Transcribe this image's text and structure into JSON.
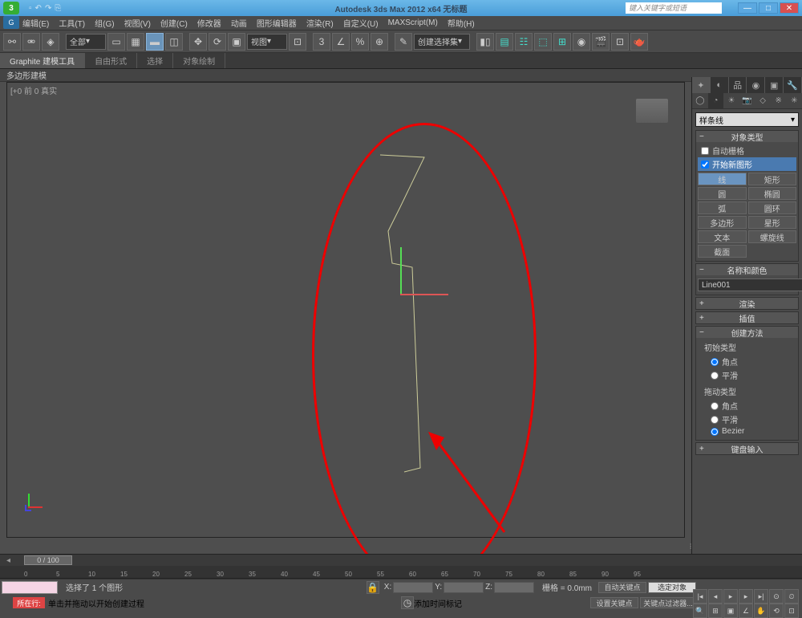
{
  "title": "Autodesk 3ds Max 2012 x64   无标题",
  "search_placeholder": "键入关键字或短语",
  "menus": [
    "编辑(E)",
    "工具(T)",
    "组(G)",
    "视图(V)",
    "创建(C)",
    "修改器",
    "动画",
    "图形编辑器",
    "渲染(R)",
    "自定义(U)",
    "MAXScript(M)",
    "帮助(H)"
  ],
  "toolbar": {
    "sel_filter": "全部",
    "view_label": "视图",
    "cmd_set": "创建选择集"
  },
  "ribbon": {
    "tabs": [
      "Graphite 建模工具",
      "自由形式",
      "选择",
      "对象绘制"
    ],
    "row": "多边形建模"
  },
  "viewport": {
    "label": "[+0 前 0 真实"
  },
  "panel": {
    "dropdown": "样条线",
    "object_type": "对象类型",
    "auto_grid": "自动栅格",
    "start_new": "开始新图形",
    "shapes": [
      [
        "线",
        "矩形"
      ],
      [
        "圆",
        "椭圆"
      ],
      [
        "弧",
        "圆环"
      ],
      [
        "多边形",
        "星形"
      ],
      [
        "文本",
        "螺旋线"
      ],
      [
        "截面",
        ""
      ]
    ],
    "name_color": "名称和颜色",
    "obj_name": "Line001",
    "render": "渲染",
    "interp": "插值",
    "create_method": "创建方法",
    "initial_type": "初始类型",
    "drag_type": "拖动类型",
    "corner": "角点",
    "smooth": "平滑",
    "bezier": "Bezier",
    "keyboard": "键盘输入"
  },
  "timeline": {
    "range": "0 / 100"
  },
  "status": {
    "sel": "选择了 1 个图形",
    "hint": "单击并拖动以开始创建过程",
    "grid": "栅格 = 0.0mm",
    "autokey": "自动关键点",
    "selset": "选定对象",
    "setkey": "设置关键点",
    "keyfilter": "关键点过滤器...",
    "addtime": "添加时间标记",
    "current": "所在行:",
    "x": "X:",
    "y": "Y:",
    "z": "Z:"
  }
}
